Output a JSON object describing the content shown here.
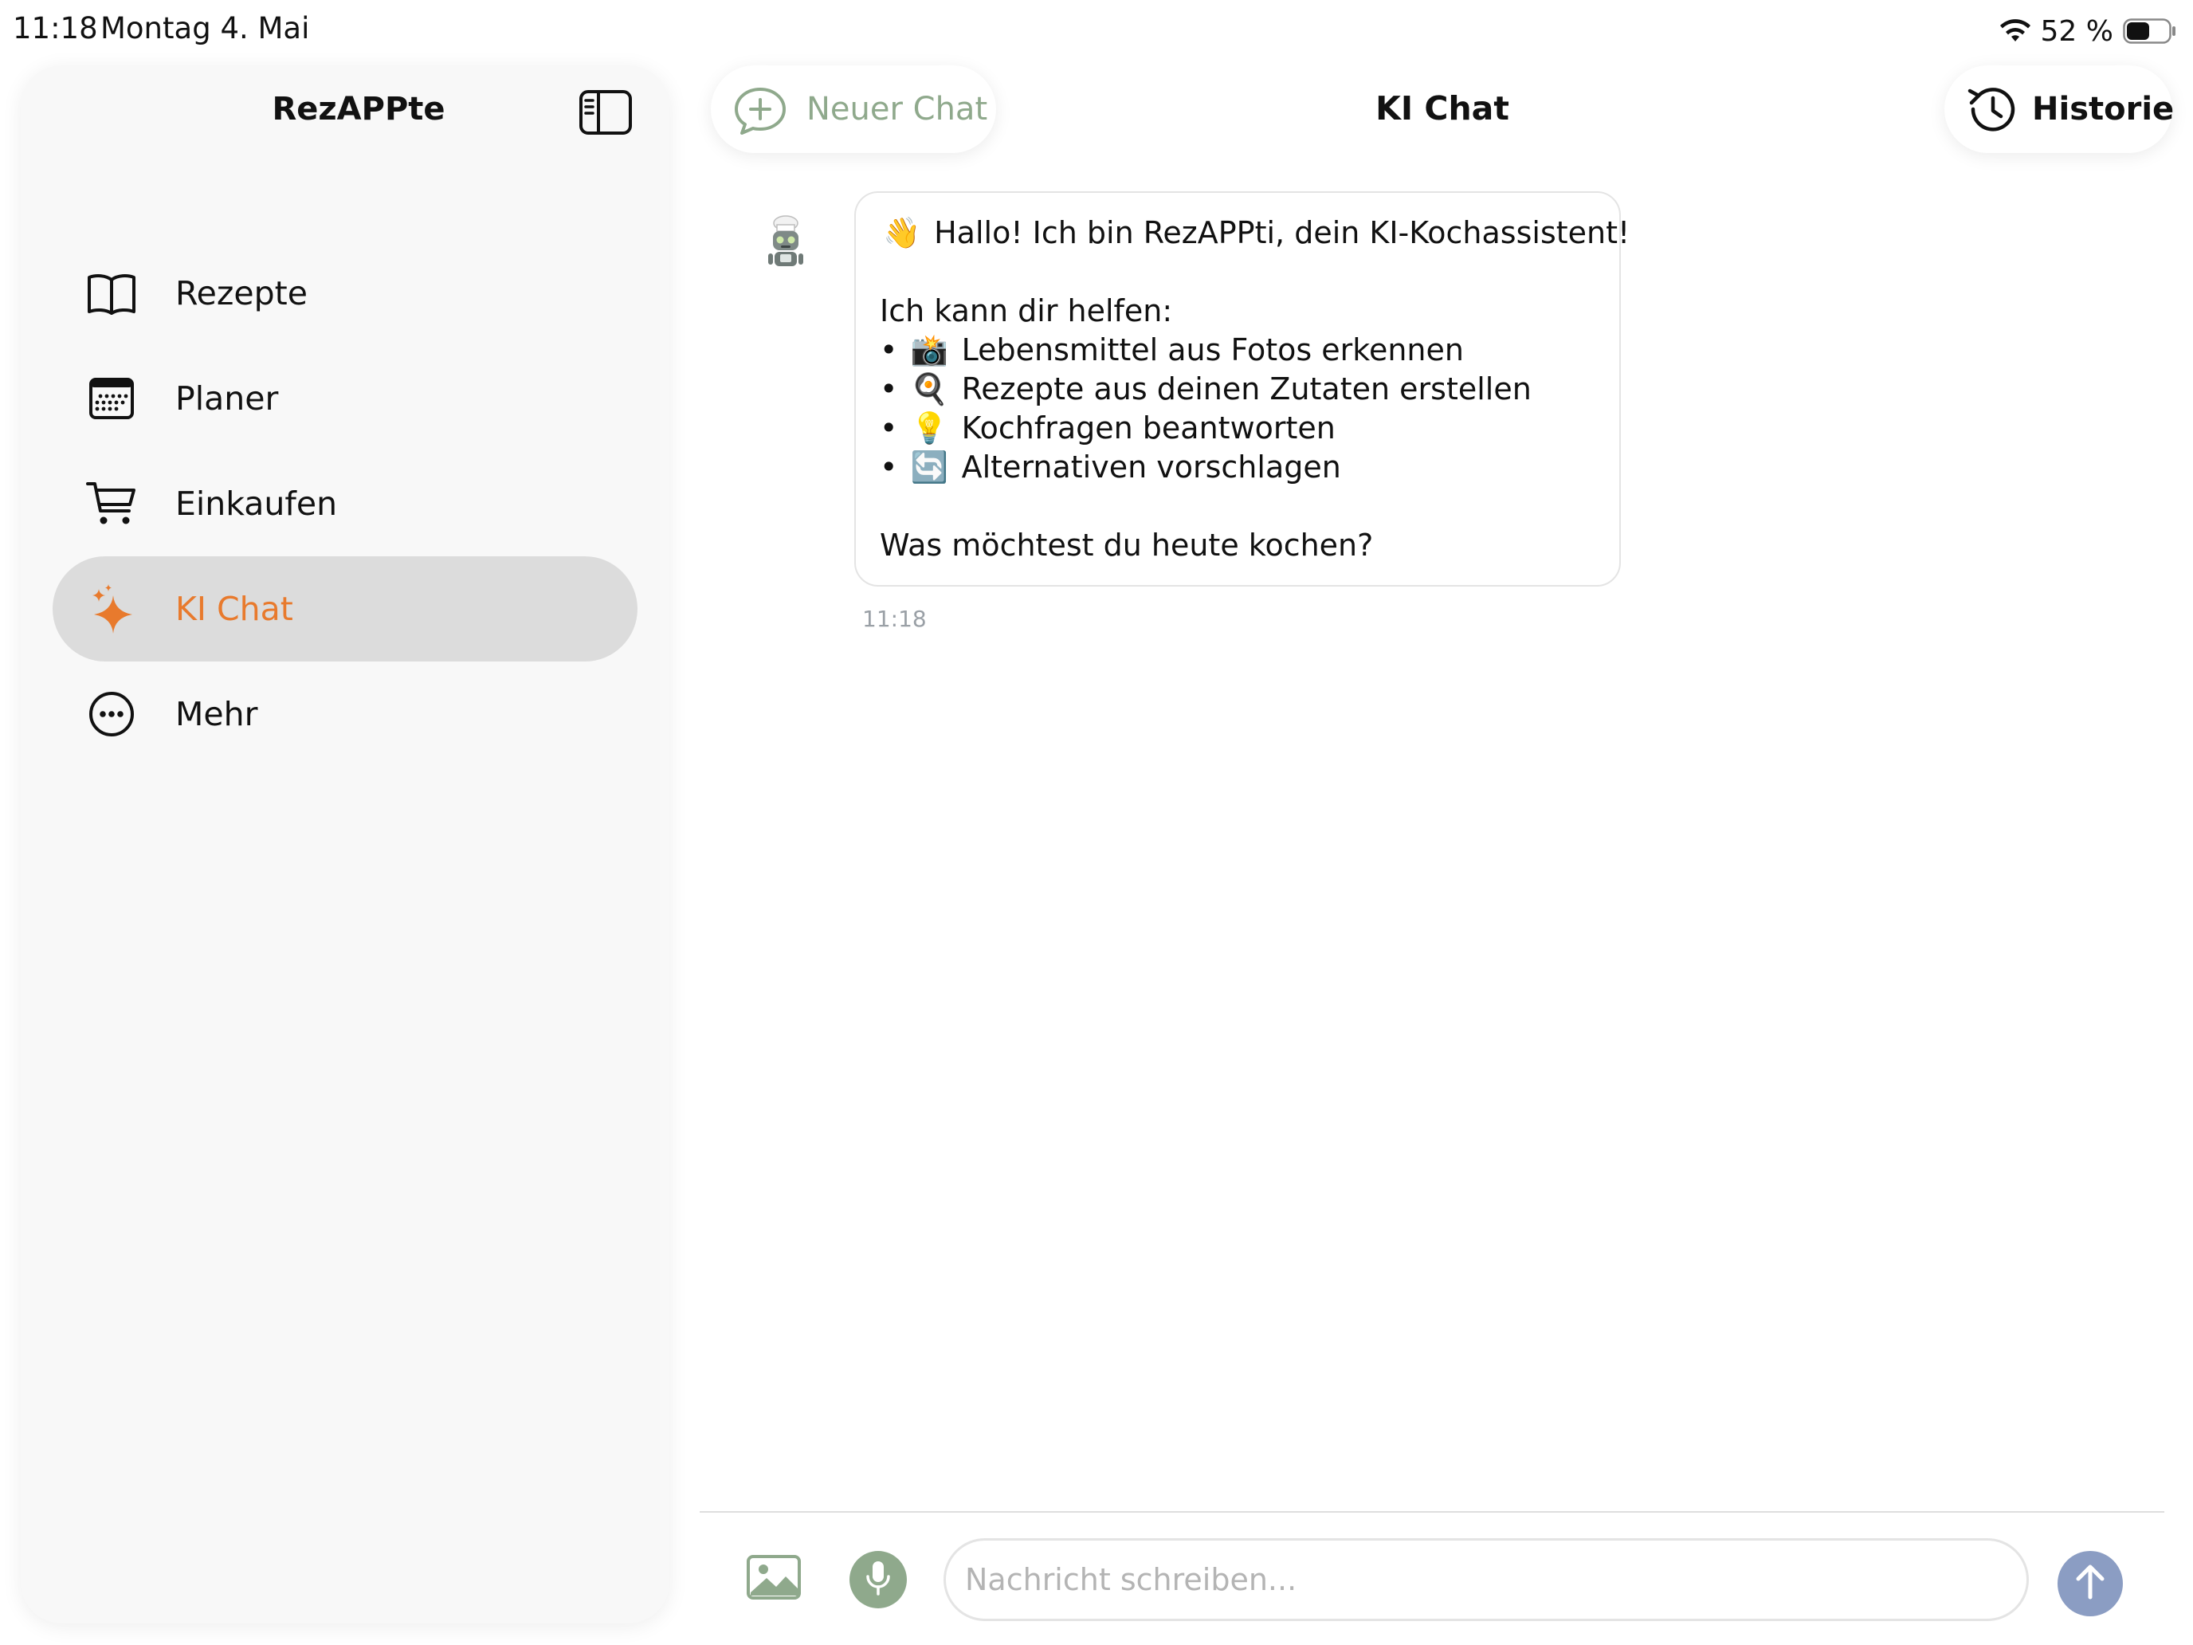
{
  "status_bar": {
    "time": "11:18",
    "date": "Montag 4. Mai",
    "battery": "52 %"
  },
  "sidebar": {
    "title": "RezAPPte",
    "items": [
      {
        "label": "Rezepte",
        "icon": "book-icon",
        "active": false
      },
      {
        "label": "Planer",
        "icon": "calendar-icon",
        "active": false
      },
      {
        "label": "Einkaufen",
        "icon": "cart-icon",
        "active": false
      },
      {
        "label": "KI Chat",
        "icon": "sparkles-icon",
        "active": true
      },
      {
        "label": "Mehr",
        "icon": "more-icon",
        "active": false
      }
    ]
  },
  "header": {
    "new_chat_label": "Neuer Chat",
    "title": "KI Chat",
    "history_label": "Historie"
  },
  "chat": {
    "messages": [
      {
        "sender": "assistant",
        "avatar": "robot-chef-icon",
        "time": "11:18",
        "lines": [
          {
            "bullet": "",
            "emoji": "👋",
            "text": "Hallo! Ich bin RezAPPti, dein KI-Kochassistent!"
          },
          {
            "bullet": "",
            "emoji": "",
            "text": "Ich kann dir helfen:"
          },
          {
            "bullet": "•",
            "emoji": "📸",
            "text": "Lebensmittel aus Fotos erkennen"
          },
          {
            "bullet": "•",
            "emoji": "🍳",
            "text": "Rezepte aus deinen Zutaten erstellen"
          },
          {
            "bullet": "•",
            "emoji": "💡",
            "text": "Kochfragen beantworten"
          },
          {
            "bullet": "•",
            "emoji": "🔄",
            "text": "Alternativen vorschlagen"
          },
          {
            "bullet": "",
            "emoji": "",
            "text": "Was möchtest du heute kochen?"
          }
        ]
      }
    ]
  },
  "composer": {
    "placeholder": "Nachricht schreiben...",
    "value": ""
  },
  "colors": {
    "accent": "#E87A2D",
    "sage": "#8FA98C",
    "send": "#8B9DC3",
    "active_bg": "#DCDCDC"
  }
}
